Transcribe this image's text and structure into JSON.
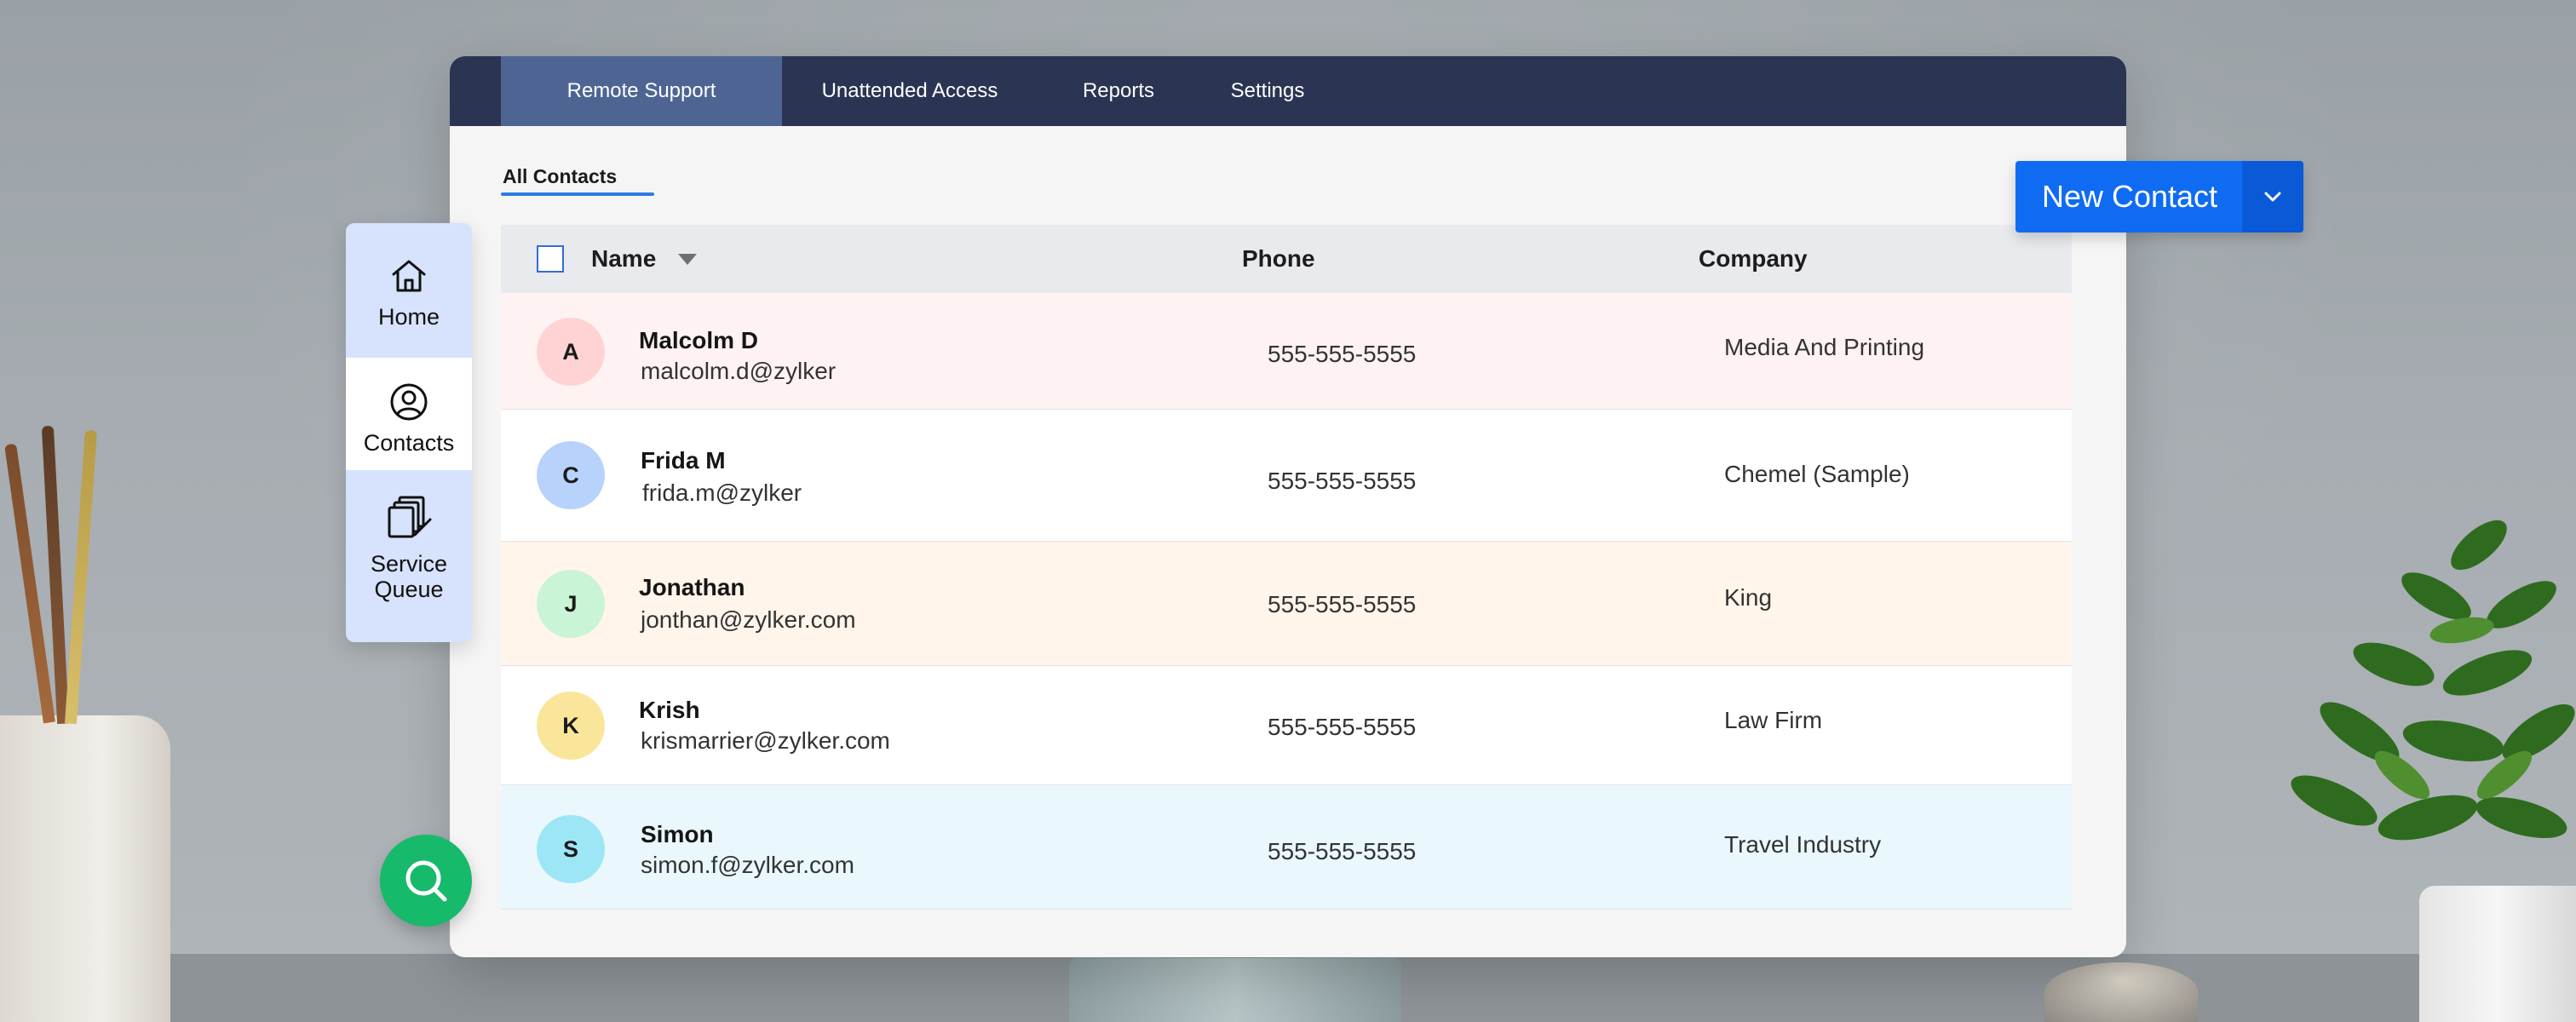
{
  "nav": {
    "tabs": [
      {
        "label": "Remote Support",
        "active": true
      },
      {
        "label": "Unattended Access",
        "active": false
      },
      {
        "label": "Reports",
        "active": false
      },
      {
        "label": "Settings",
        "active": false
      }
    ]
  },
  "subtabs": {
    "all_contacts": "All Contacts"
  },
  "actions": {
    "new_contact": "New Contact"
  },
  "table": {
    "headers": {
      "name": "Name",
      "phone": "Phone",
      "company": "Company"
    },
    "rows": [
      {
        "initial": "A",
        "name": "Malcolm D",
        "email": "malcolm.d@zylker",
        "phone": "555-555-5555",
        "company": "Media And Printing",
        "row_color": "#fff2f2",
        "avatar_color": "#ffd3d3"
      },
      {
        "initial": "C",
        "name": "Frida M",
        "email": "frida.m@zylker",
        "phone": "555-555-5555",
        "company": "Chemel (Sample)",
        "row_color": "#ffffff",
        "avatar_color": "#b7d2fb"
      },
      {
        "initial": "J",
        "name": "Jonathan",
        "email": "jonthan@zylker.com",
        "phone": "555-555-5555",
        "company": "King",
        "row_color": "#fff5ea",
        "avatar_color": "#c9f4d6"
      },
      {
        "initial": "K",
        "name": "Krish",
        "email": "krismarrier@zylker.com",
        "phone": "555-555-5555",
        "company": "Law Firm",
        "row_color": "#ffffff",
        "avatar_color": "#fae69a"
      },
      {
        "initial": "S",
        "name": "Simon",
        "email": "simon.f@zylker.com",
        "phone": "555-555-5555",
        "company": "Travel Industry",
        "row_color": "#eaf7fd",
        "avatar_color": "#9de6f6"
      }
    ]
  },
  "sidebar": {
    "items": [
      {
        "label": "Home",
        "icon": "home-icon"
      },
      {
        "label": "Contacts",
        "icon": "contact-icon"
      },
      {
        "label_line1": "Service",
        "label_line2": "Queue",
        "icon": "service-queue-icon"
      }
    ]
  },
  "colors": {
    "nav_bg": "#2b3453",
    "nav_active": "#4e6594",
    "accent": "#0f6cf2",
    "search_fab": "#17b96a"
  }
}
